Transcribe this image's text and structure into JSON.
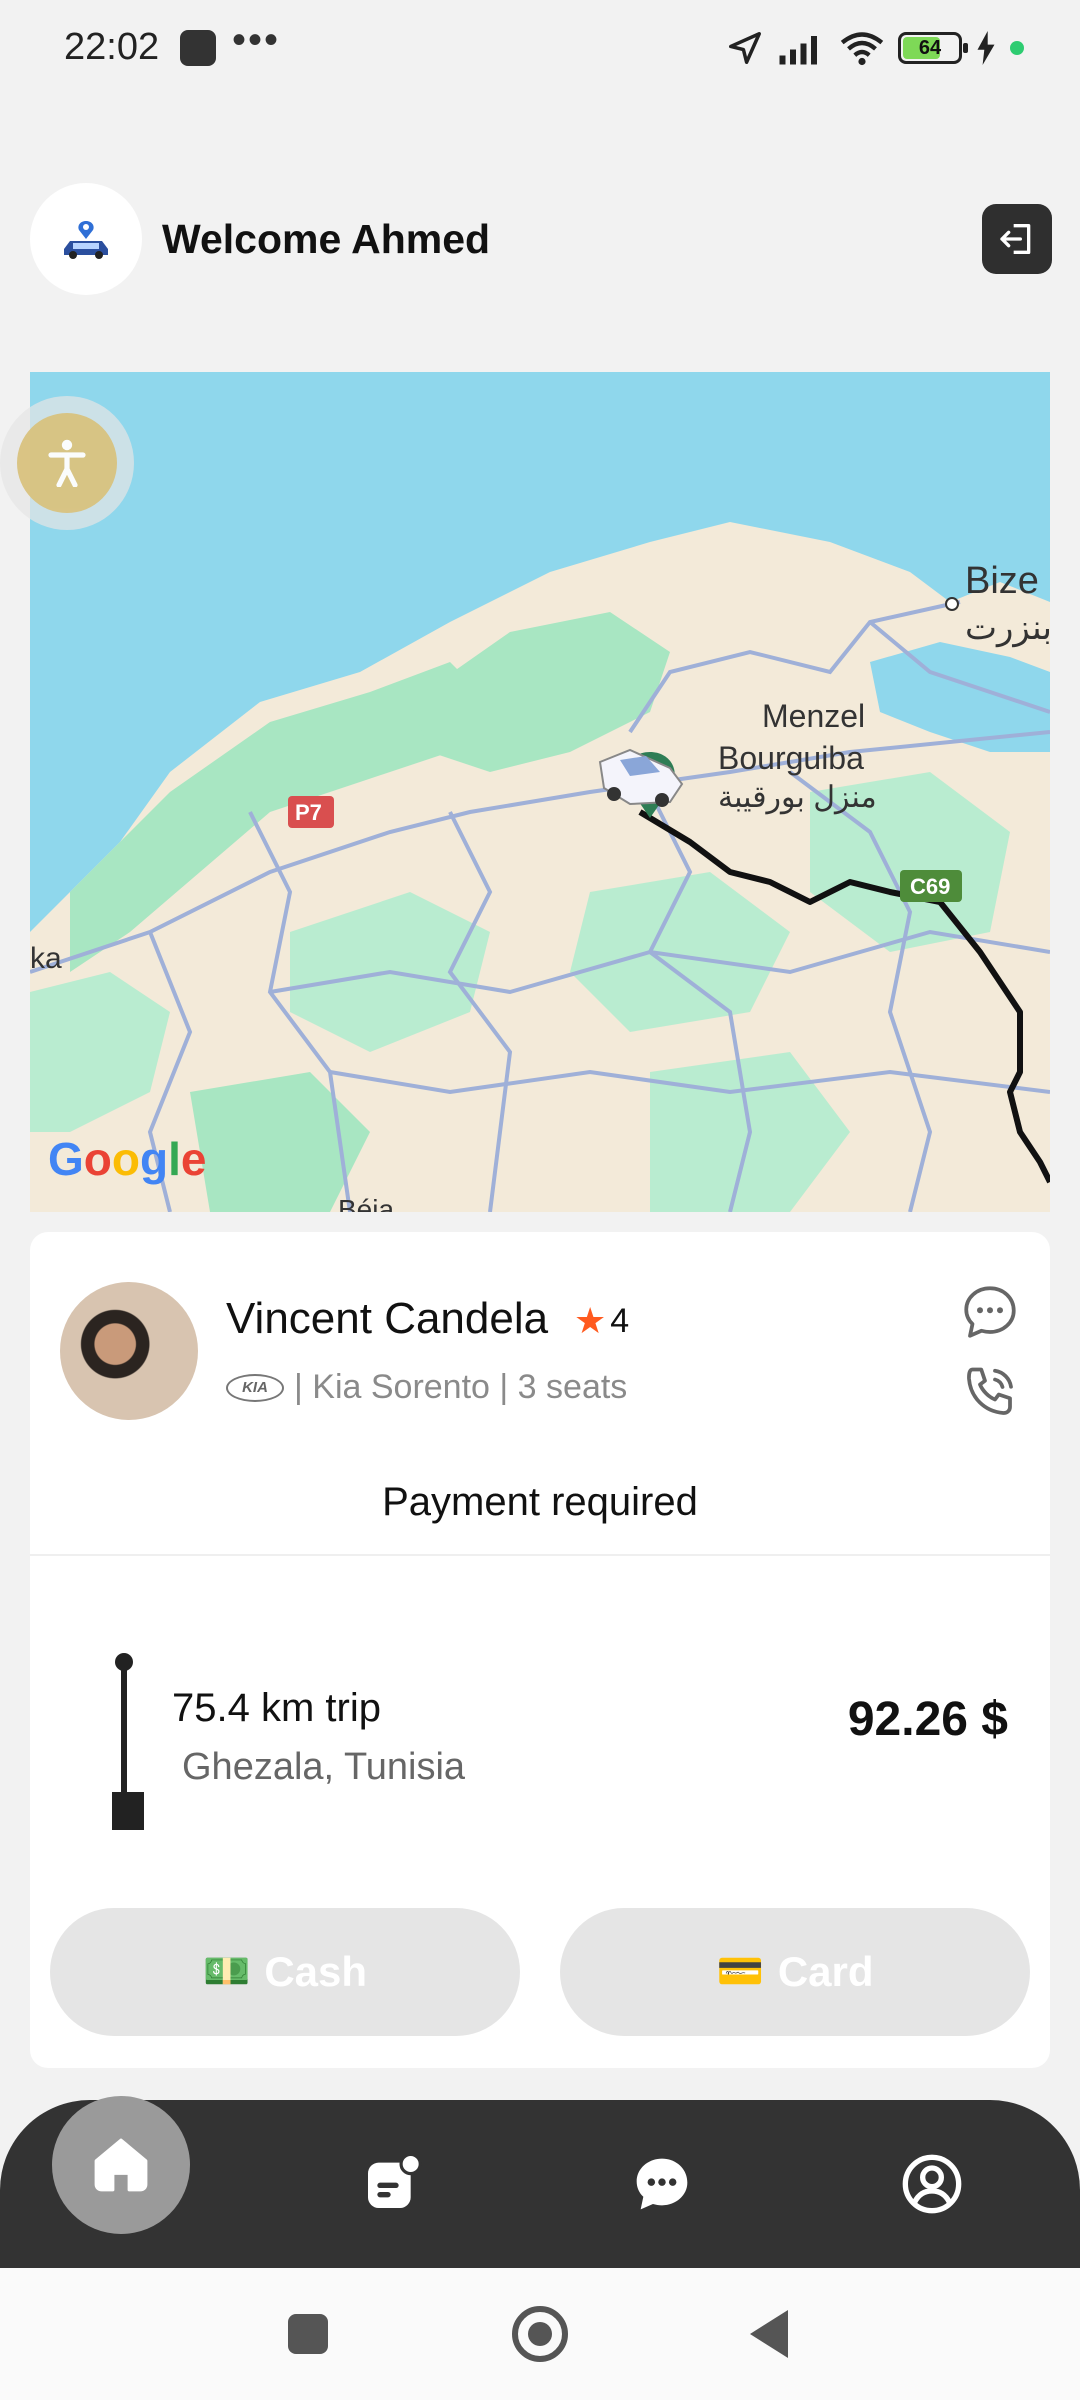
{
  "status_bar": {
    "time": "22:02",
    "dots": "•••",
    "battery": "64"
  },
  "header": {
    "welcome": "Welcome Ahmed"
  },
  "map": {
    "labels": {
      "bizerte": "Bize",
      "bizerte_ar": "بنزرت",
      "menzel": "Menzel",
      "bourguiba": "Bourguiba",
      "menzel_ar": "منزل بورقيبة",
      "p7": "P7",
      "c69": "C69",
      "ka": "ka",
      "beja": "Béja"
    },
    "google": [
      "G",
      "o",
      "o",
      "g",
      "l",
      "e"
    ],
    "google_colors": [
      "#4285F4",
      "#EA4335",
      "#FBBC05",
      "#4285F4",
      "#34A853",
      "#EA4335"
    ]
  },
  "driver": {
    "name": "Vincent Candela",
    "star": "★",
    "rating": "4",
    "car_brand": "KIA",
    "car_info": "| Kia Sorento | 3 seats"
  },
  "payment": {
    "title": "Payment required",
    "distance": "75.4 km trip",
    "destination": "Ghezala, Tunisia",
    "price": "92.26 $",
    "cash_emoji": "💵",
    "cash_label": "Cash",
    "card_emoji": "💳",
    "card_label": "Card"
  },
  "nav": {
    "items": [
      "home-icon",
      "orders-icon",
      "chat-icon",
      "profile-icon"
    ],
    "active": "home-icon"
  },
  "colors": {
    "accent_dark": "#333333",
    "star": "#ff5a1f",
    "route": "#111111"
  }
}
